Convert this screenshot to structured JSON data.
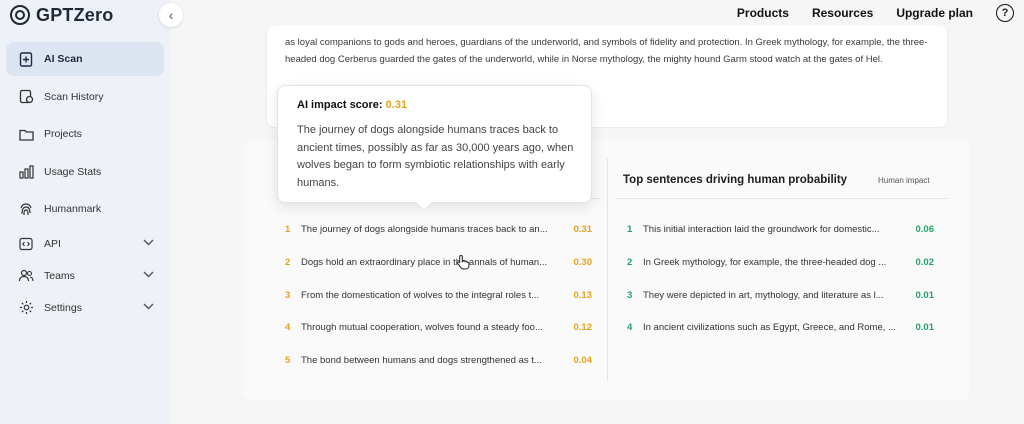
{
  "app": {
    "name": "GPTZero"
  },
  "sidebar": {
    "collapse_glyph": "‹",
    "items": [
      {
        "label": "AI Scan",
        "icon": "file-plus-icon",
        "active": true
      },
      {
        "label": "Scan History",
        "icon": "history-icon"
      },
      {
        "label": "Projects",
        "icon": "folder-icon"
      },
      {
        "label": "Usage Stats",
        "icon": "bar-chart-icon"
      },
      {
        "label": "Humanmark",
        "icon": "fingerprint-icon"
      },
      {
        "label": "API",
        "icon": "code-icon",
        "expandable": true
      },
      {
        "label": "Teams",
        "icon": "users-icon",
        "expandable": true
      },
      {
        "label": "Settings",
        "icon": "gear-icon",
        "expandable": true
      }
    ]
  },
  "header": {
    "links": [
      "Products",
      "Resources",
      "Upgrade plan"
    ],
    "help_glyph": "?"
  },
  "document": {
    "text": "as loyal companions to gods and heroes, guardians of the underworld, and symbols of fidelity and protection. In Greek mythology, for example, the three-headed dog Cerberus guarded the gates of the underworld, while in Norse mythology, the mighty hound Garm stood watch at the gates of Hel."
  },
  "tooltip": {
    "title": "AI impact score:",
    "score": "0.31",
    "body": "The journey of dogs alongside humans traces back to ancient times, possibly as far as 30,000 years ago, when wolves began to form symbiotic relationships with early humans."
  },
  "human_panel": {
    "title": "Top sentences driving human probability",
    "subtitle": "Human impact",
    "rows": [
      {
        "num": "1",
        "text": "This initial interaction laid the groundwork for domestic...",
        "score": "0.06"
      },
      {
        "num": "2",
        "text": "In Greek mythology, for example, the three-headed dog ...",
        "score": "0.02"
      },
      {
        "num": "3",
        "text": "They were depicted in art, mythology, and literature as l...",
        "score": "0.01"
      },
      {
        "num": "4",
        "text": "In ancient civilizations such as Egypt, Greece, and Rome, ...",
        "score": "0.01"
      }
    ]
  },
  "ai_panel": {
    "rows": [
      {
        "num": "1",
        "text": "The journey of dogs alongside humans traces back to an...",
        "score": "0.31"
      },
      {
        "num": "2",
        "text": "Dogs hold an extraordinary place in the annals of human...",
        "score": "0.30"
      },
      {
        "num": "3",
        "text": "From the domestication of wolves to the integral roles t...",
        "score": "0.13"
      },
      {
        "num": "4",
        "text": "Through mutual cooperation, wolves found a steady foo...",
        "score": "0.12"
      },
      {
        "num": "5",
        "text": "The bond between humans and dogs strengthened as t...",
        "score": "0.04"
      }
    ]
  },
  "colors": {
    "ai": "#e3a21a",
    "human": "#23a36a",
    "active_nav": "#dde4f2"
  }
}
